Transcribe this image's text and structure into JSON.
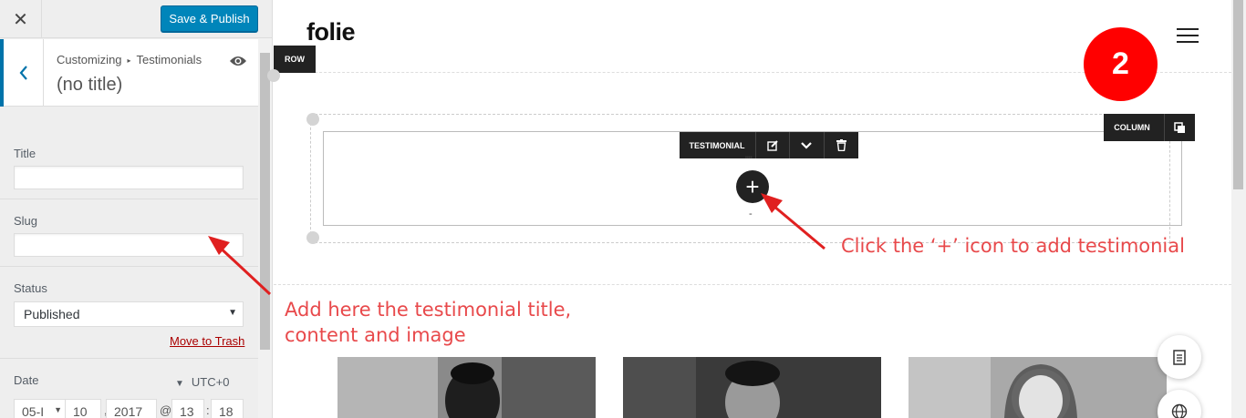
{
  "sidebar": {
    "save_label": "Save & Publish",
    "breadcrumb": {
      "root": "Customizing",
      "section": "Testimonials"
    },
    "section_title": "(no title)",
    "fields": {
      "title_label": "Title",
      "title_value": "",
      "slug_label": "Slug",
      "slug_value": "",
      "status_label": "Status",
      "status_value": "Published",
      "trash_link": "Move to Trash",
      "date_label": "Date",
      "timezone": "UTC+0",
      "date_month": "05-I",
      "date_day": "10",
      "date_year": "2017",
      "date_at": "@",
      "date_hour": "13",
      "date_colon": ":",
      "date_minute": "18",
      "date_comma": ","
    }
  },
  "preview": {
    "logo": "folie",
    "row_tag": "ROW",
    "column_tag": "COLUMN",
    "module_tag": "TESTIMONIAL",
    "module_quote": "\"\"",
    "module_dash": "-",
    "plus": "+",
    "step_badge": "2",
    "instruction_add": "Click the ‘+’ icon to add testimonial",
    "instruction_fields_line1": "Add here the testimonial title,",
    "instruction_fields_line2": "content and image"
  },
  "colors": {
    "accent": "#0085ba",
    "annotation": "#e8494b",
    "badge": "#ff0000",
    "toolbar": "#222222"
  },
  "icons": [
    "close-icon",
    "chevron-left-icon",
    "eye-icon",
    "hamburger-icon",
    "edit-icon",
    "chevron-down-icon",
    "trash-icon",
    "copy-icon",
    "plus-icon",
    "document-icon",
    "globe-icon"
  ]
}
